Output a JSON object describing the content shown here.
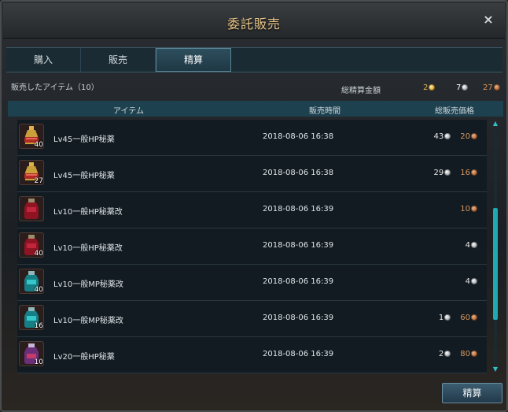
{
  "window": {
    "title": "委託販売",
    "close": "×"
  },
  "tabs": [
    {
      "label": "購入"
    },
    {
      "label": "販売"
    },
    {
      "label": "精算"
    }
  ],
  "summary": {
    "sold_items_label": "販売したアイテム（10）",
    "total_label": "総精算金額",
    "gold": "2",
    "silver": "7",
    "copper": "27"
  },
  "columns": {
    "item": "アイテム",
    "time": "販売時間",
    "price": "総販売価格"
  },
  "rows": [
    {
      "name": "Lv45一般HP秘薬",
      "qty": "40",
      "time": "2018-08-06 16:38",
      "silver": "43",
      "copper": "20",
      "icon": "hp-elixir-scroll-icon"
    },
    {
      "name": "Lv45一般HP秘薬",
      "qty": "27",
      "time": "2018-08-06 16:38",
      "silver": "29",
      "copper": "16",
      "icon": "hp-elixir-scroll-icon"
    },
    {
      "name": "Lv10一般HP秘薬改",
      "qty": "",
      "time": "2018-08-06 16:39",
      "silver": "",
      "copper": "10",
      "icon": "red-potion-icon"
    },
    {
      "name": "Lv10一般HP秘薬改",
      "qty": "40",
      "time": "2018-08-06 16:39",
      "silver": "4",
      "copper": "",
      "icon": "red-potion-icon"
    },
    {
      "name": "Lv10一般MP秘薬改",
      "qty": "40",
      "time": "2018-08-06 16:39",
      "silver": "4",
      "copper": "",
      "icon": "blue-potion-icon"
    },
    {
      "name": "Lv10一般MP秘薬改",
      "qty": "16",
      "time": "2018-08-06 16:39",
      "silver": "1",
      "copper": "60",
      "icon": "blue-potion-icon"
    },
    {
      "name": "Lv20一般HP秘薬",
      "qty": "10",
      "time": "2018-08-06 16:39",
      "silver": "2",
      "copper": "80",
      "icon": "purple-potion-icon"
    }
  ],
  "scroll": {
    "position": 0.43
  },
  "settle_button": "精算",
  "colors": {
    "accent": "#1fa9b0",
    "title": "#e9c88a",
    "gold": "#e0b050",
    "copper": "#d8975d"
  }
}
